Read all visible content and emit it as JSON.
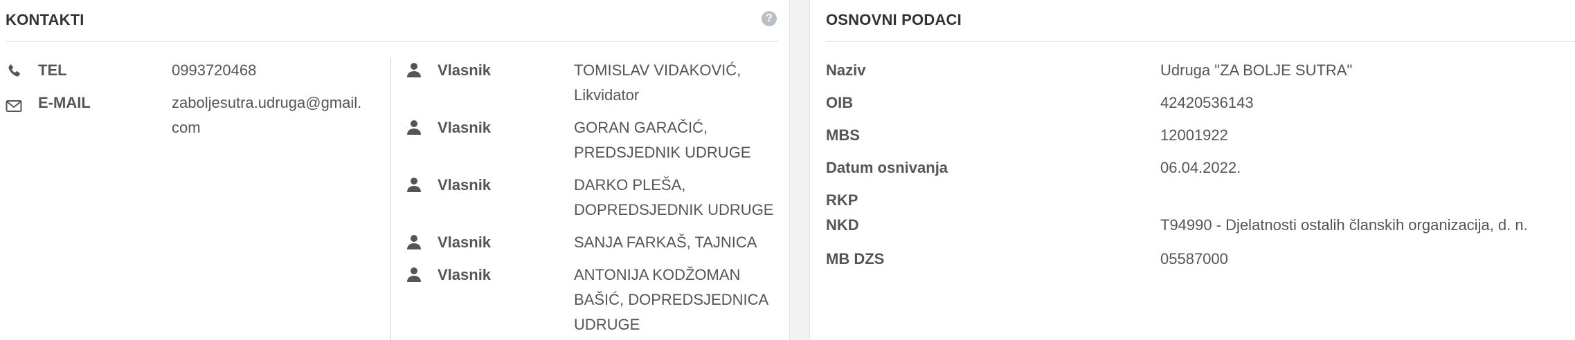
{
  "contacts": {
    "title": "KONTAKTI",
    "phone": {
      "icon": "phone-icon",
      "label": "TEL",
      "value": "0993720468"
    },
    "email": {
      "icon": "envelope-icon",
      "label": "E-MAIL",
      "value_line1": "zaboljesutra.udruga@gmail.",
      "value_line2": "com"
    }
  },
  "owners": [
    {
      "role": "Vlasnik",
      "line1": "TOMISLAV VIDAKOVIĆ,",
      "line2": "Likvidator",
      "line3": ""
    },
    {
      "role": "Vlasnik",
      "line1": "GORAN GARAČIĆ,",
      "line2": "PREDSJEDNIK UDRUGE",
      "line3": ""
    },
    {
      "role": "Vlasnik",
      "line1": "DARKO PLEŠA,",
      "line2": "DOPREDSJEDNIK UDRUGE",
      "line3": ""
    },
    {
      "role": "Vlasnik",
      "line1": "SANJA FARKAŠ, TAJNICA",
      "line2": "",
      "line3": ""
    },
    {
      "role": "Vlasnik",
      "line1": "ANTONIJA KODŽOMAN",
      "line2": "BAŠIĆ, DOPREDSJEDNICA",
      "line3": "UDRUGE"
    }
  ],
  "basic": {
    "title": "OSNOVNI PODACI",
    "rows": [
      {
        "label": "Naziv",
        "value": "Udruga \"ZA BOLJE SUTRA\""
      },
      {
        "label": "OIB",
        "value": "42420536143"
      },
      {
        "label": "MBS",
        "value": "12001922"
      },
      {
        "label": "Datum osnivanja",
        "value": "06.04.2022."
      },
      {
        "label": "RKP",
        "value": ""
      },
      {
        "label": "NKD",
        "value": "T94990 - Djelatnosti ostalih članskih organizacija, d. n."
      },
      {
        "label": "MB DZS",
        "value": "05587000"
      }
    ]
  },
  "help_icon": "question-circle-icon"
}
